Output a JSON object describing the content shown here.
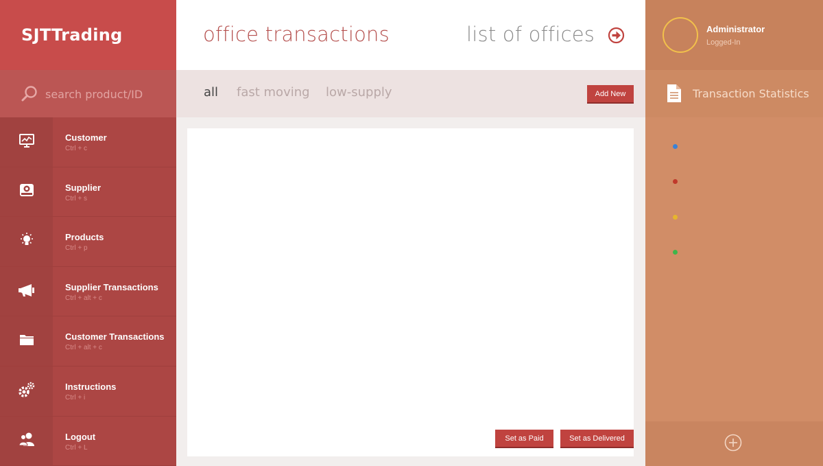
{
  "app": {
    "logo_bold": "SJT",
    "logo_rest": "Trading"
  },
  "search": {
    "placeholder": "search product/ID"
  },
  "nav": {
    "items": [
      {
        "label": "Customer",
        "shortcut": "Ctrl + c",
        "icon": "presentation-chart-icon"
      },
      {
        "label": "Supplier",
        "shortcut": "Ctrl + s",
        "icon": "inbox-tray-icon"
      },
      {
        "label": "Products",
        "shortcut": "Ctrl + p",
        "icon": "lightbulb-icon"
      },
      {
        "label": "Supplier Transactions",
        "shortcut": "Ctrl + alt + c",
        "icon": "megaphone-icon"
      },
      {
        "label": "Customer Transactions",
        "shortcut": "Ctrl + alt + c",
        "icon": "folder-icon"
      },
      {
        "label": "Instructions",
        "shortcut": "Ctrl + i",
        "icon": "gears-icon"
      },
      {
        "label": "Logout",
        "shortcut": "Ctrl + L",
        "icon": "users-icon"
      }
    ]
  },
  "header": {
    "title": "office transactions",
    "offices_link": "list of offices"
  },
  "filters": {
    "tabs": [
      "all",
      "fast moving",
      "low-supply"
    ],
    "active_tab": "all",
    "add_new": "Add New"
  },
  "actions": {
    "set_paid": "Set as Paid",
    "set_delivered": "Set as Delivered"
  },
  "user": {
    "name": "Administrator",
    "status": "Logged-In"
  },
  "stats": {
    "title": "Transaction Statistics",
    "legend_colors": [
      "#3b82d6",
      "#c0392b",
      "#e6b52e",
      "#3fb54a"
    ]
  },
  "colors": {
    "brand_red": "#c84c4b",
    "button_red": "#c0433f",
    "accent_orange": "#d18d67",
    "avatar_ring": "#f2c14b"
  }
}
